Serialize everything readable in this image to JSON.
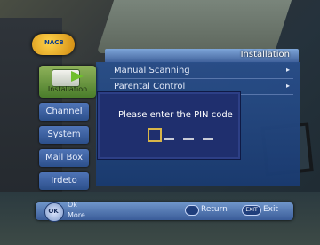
{
  "brand": {
    "logo_text": "NACB"
  },
  "header": {
    "title": "Installation"
  },
  "sidebar": {
    "selected_label": "Installation",
    "items": [
      {
        "label": "Channel"
      },
      {
        "label": "System"
      },
      {
        "label": "Mail Box"
      },
      {
        "label": "Irdeto"
      }
    ]
  },
  "menu": {
    "items": [
      {
        "label": "Manual Scanning",
        "arrow": "▸"
      },
      {
        "label": "Parental Control",
        "arrow": "▸"
      }
    ]
  },
  "pin_dialog": {
    "message": "Please enter the PIN code",
    "digits_total": 4
  },
  "footer": {
    "ok_hint": "Ok",
    "more_hint": "More",
    "dpad_label": "OK",
    "return_label": "Return",
    "exit_key": "EXIT",
    "exit_label": "Exit"
  },
  "colors": {
    "accent": "#3d5e98",
    "selected_tab": "#6fbf2c",
    "dialog_bg": "#1f2f6e",
    "pin_cursor": "#d9b648"
  }
}
